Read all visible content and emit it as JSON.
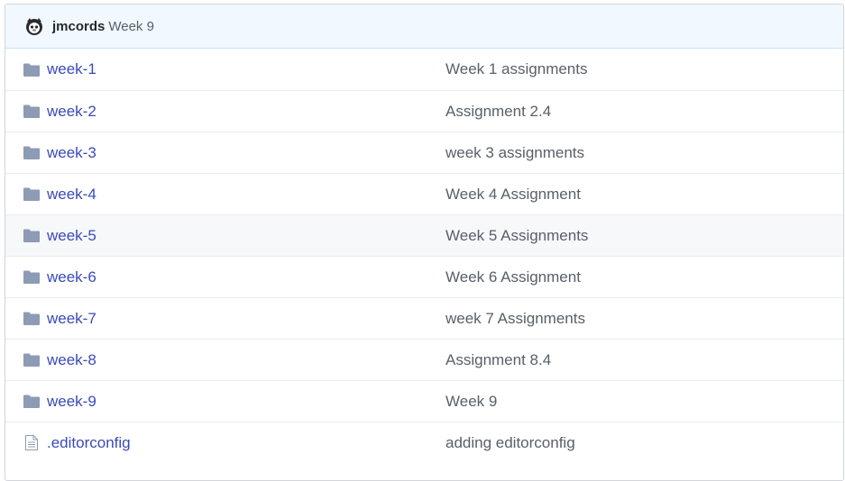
{
  "commit_header": {
    "author": "jmcords",
    "message": "Week 9"
  },
  "files": [
    {
      "type": "folder",
      "name": "week-1",
      "message": "Week 1 assignments"
    },
    {
      "type": "folder",
      "name": "week-2",
      "message": "Assignment 2.4"
    },
    {
      "type": "folder",
      "name": "week-3",
      "message": "week 3 assignments"
    },
    {
      "type": "folder",
      "name": "week-4",
      "message": "Week 4 Assignment"
    },
    {
      "type": "folder",
      "name": "week-5",
      "message": "Week 5 Assignments"
    },
    {
      "type": "folder",
      "name": "week-6",
      "message": "Week 6 Assignment"
    },
    {
      "type": "folder",
      "name": "week-7",
      "message": "week 7 Assignments"
    },
    {
      "type": "folder",
      "name": "week-8",
      "message": "Assignment 8.4"
    },
    {
      "type": "folder",
      "name": "week-9",
      "message": "Week 9"
    },
    {
      "type": "file",
      "name": ".editorconfig",
      "message": "adding editorconfig"
    }
  ],
  "icons": {
    "folder": "folder-icon",
    "file": "file-icon"
  },
  "colors": {
    "folder_icon": "#8e9bb5",
    "link": "#3a4ab8",
    "message": "#586069",
    "header_bg": "#f1f8ff",
    "hover_row_bg": "#f6f8fa"
  }
}
